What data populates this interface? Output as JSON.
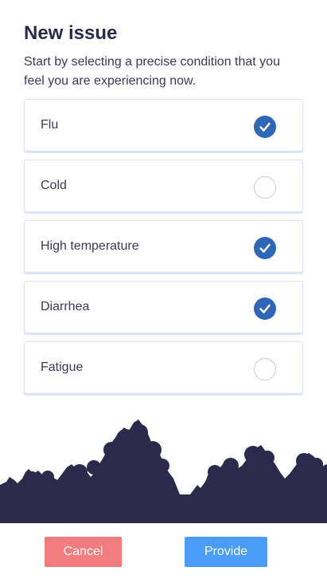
{
  "header": {
    "title": "New issue",
    "subtitle": "Start by selecting a precise condition that you feel you are experiencing now."
  },
  "conditions": [
    {
      "label": "Flu",
      "selected": true
    },
    {
      "label": "Cold",
      "selected": false
    },
    {
      "label": "High temperature",
      "selected": true
    },
    {
      "label": "Diarrhea",
      "selected": true
    },
    {
      "label": "Fatigue",
      "selected": false
    }
  ],
  "footer": {
    "cancel_label": "Cancel",
    "provide_label": "Provide"
  },
  "colors": {
    "accent": "#2e66b8",
    "cancel": "#ef7d7d",
    "provide": "#4a9cf6",
    "silhouette": "#2b2a4c"
  },
  "icons": {
    "selected": "checkmark-icon",
    "unselected": "empty-circle-icon"
  }
}
